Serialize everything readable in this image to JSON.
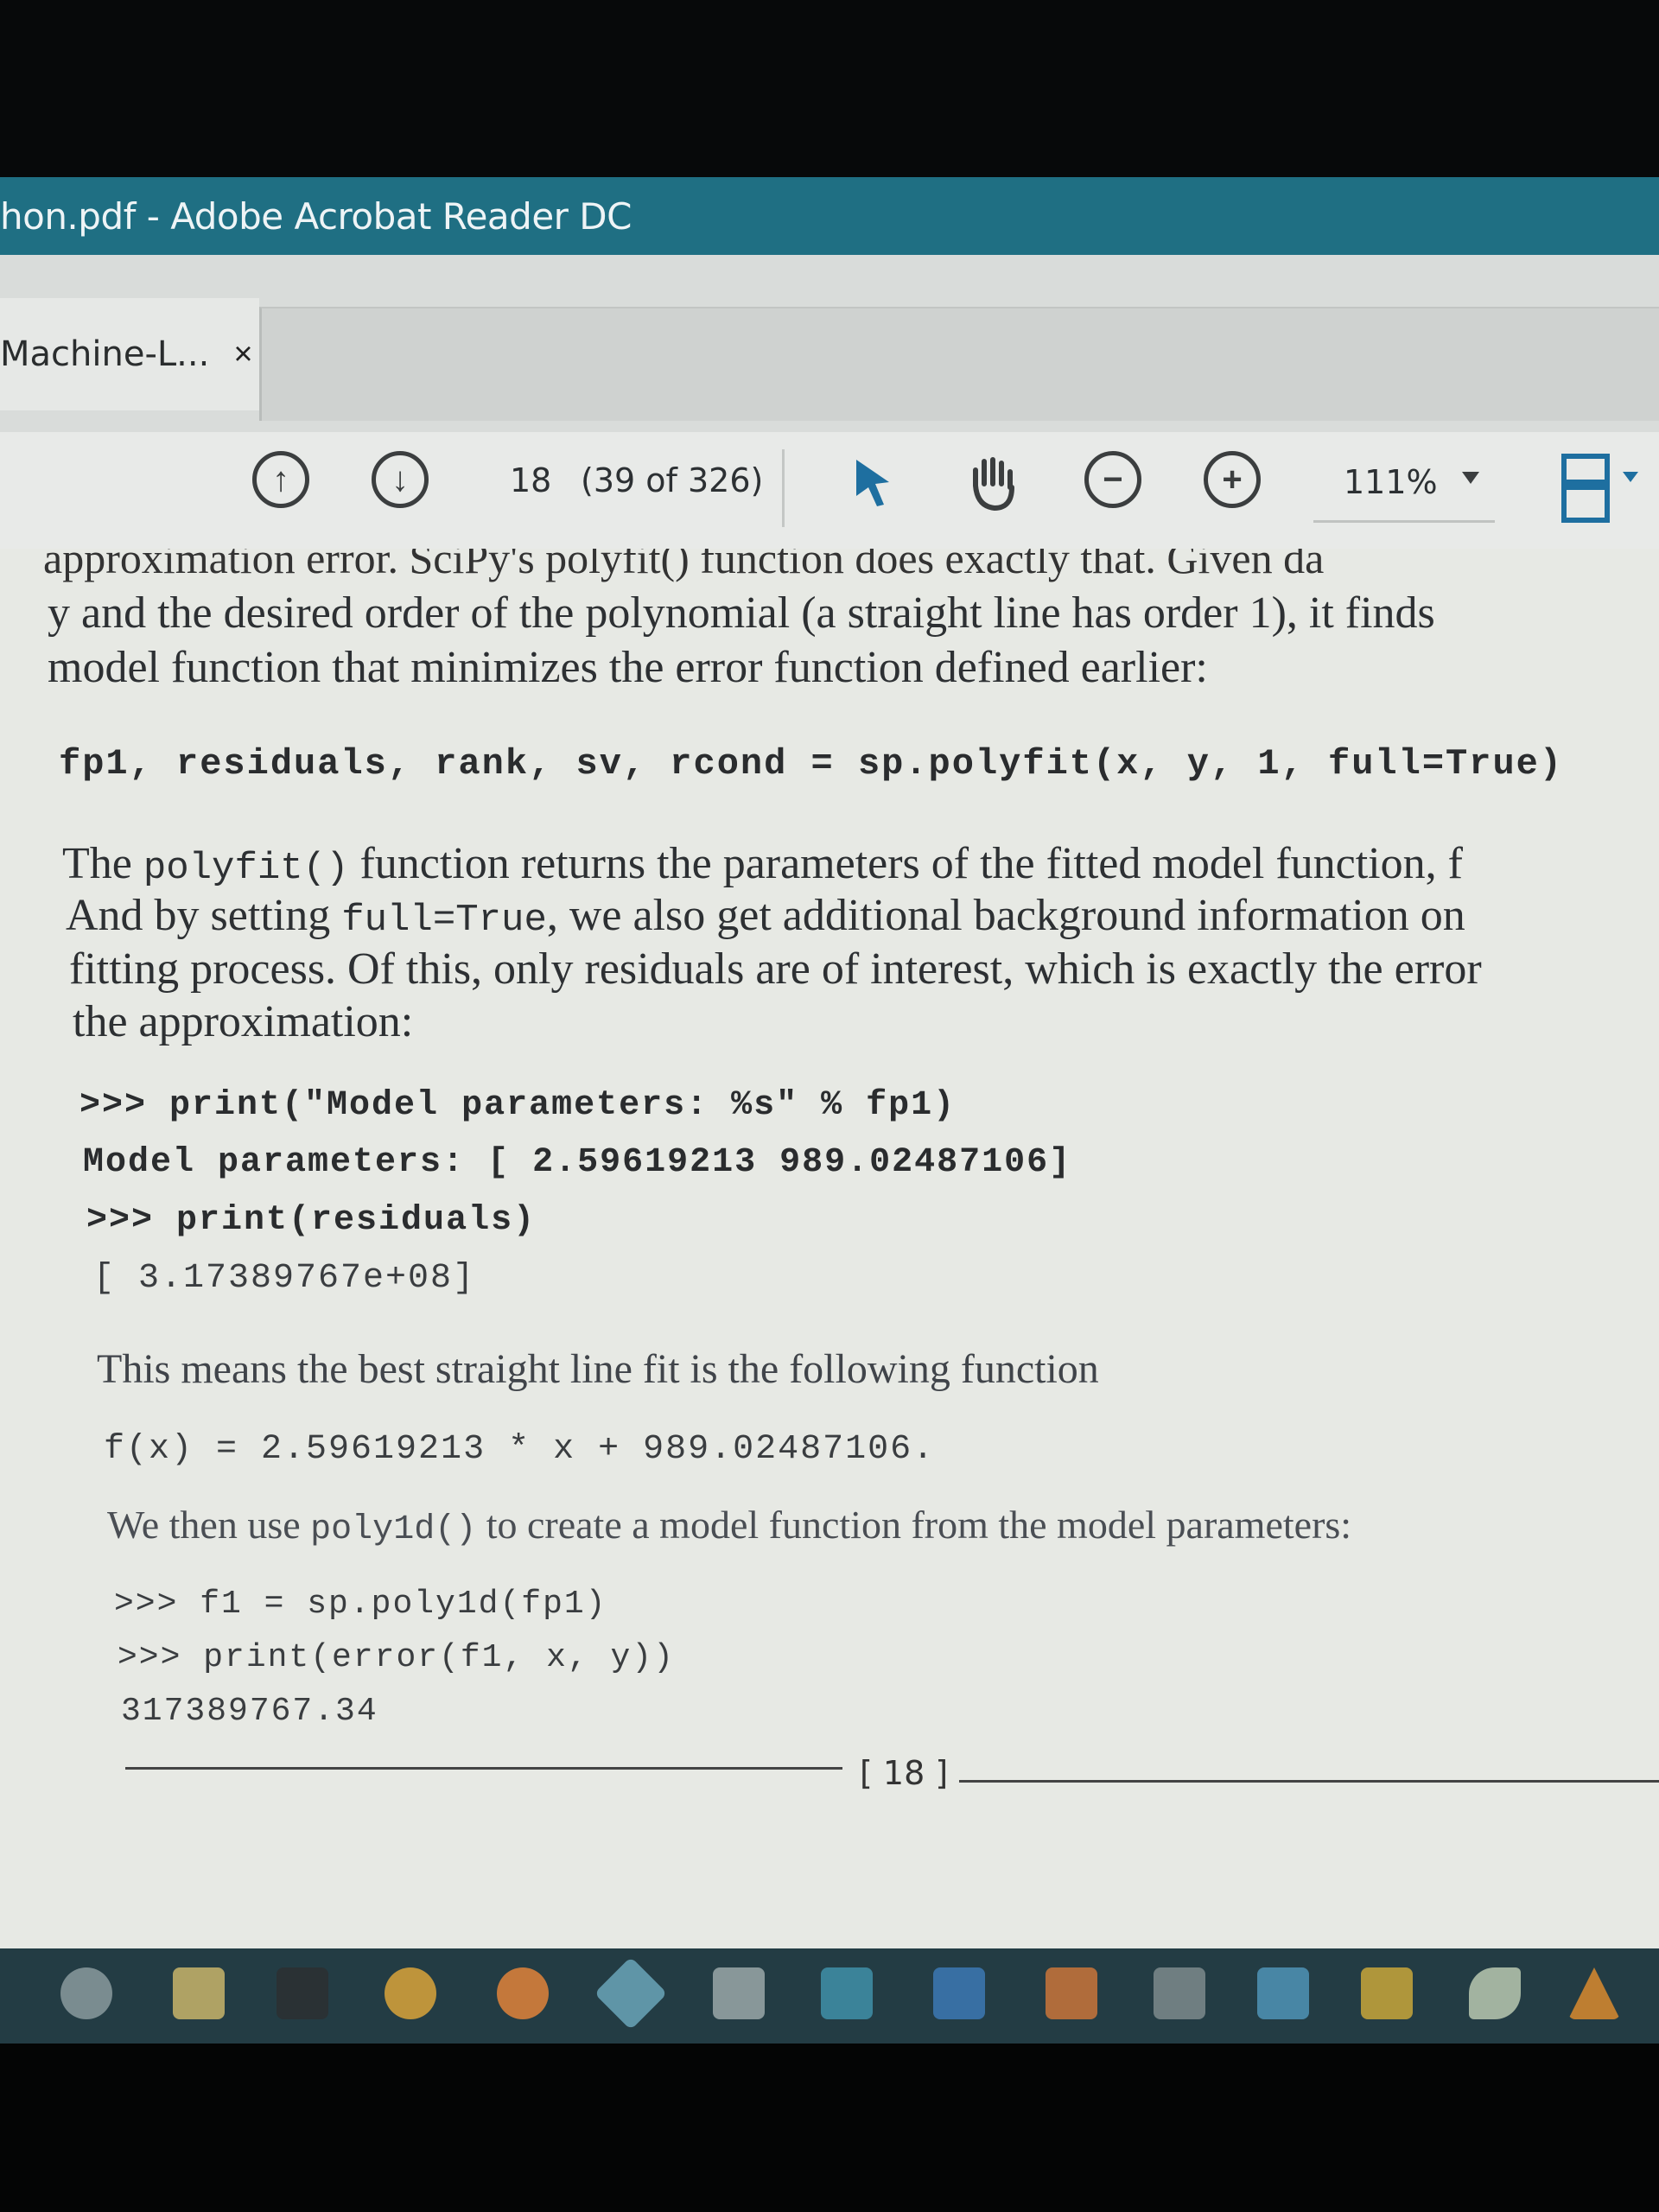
{
  "window": {
    "title": "hon.pdf - Adobe Acrobat Reader DC"
  },
  "tab": {
    "label": "Machine-L...",
    "close": "×"
  },
  "toolbar": {
    "page_number": "18",
    "page_of": "(39 of 326)",
    "zoom": "111%"
  },
  "document": {
    "cut_line": "approximation error. SciPy's polyfit() function does exactly that. Given da",
    "para1": [
      "y and the desired order of the polynomial (a straight line has order 1), it finds",
      "model function that minimizes the error function defined earlier:"
    ],
    "code1": "fp1, residuals, rank, sv, rcond = sp.polyfit(x, y, 1, full=True)",
    "para2": {
      "l1_a": "The ",
      "l1_code": "polyfit()",
      "l1_b": " function returns the parameters of the fitted model function, f",
      "l2_a": "And by setting ",
      "l2_code": "full=True",
      "l2_b": ", we also get additional background information on",
      "l3": "fitting process. Of this, only residuals are of interest, which is exactly the error",
      "l4": "the approximation:"
    },
    "code2": [
      ">>> print(\"Model parameters: %s\" % fp1)",
      "Model parameters: [   2.59619213  989.02487106]",
      ">>> print(residuals)",
      "[  3.17389767e+08]"
    ],
    "para3": "This means the best straight line fit is the following function",
    "formula": "f(x) = 2.59619213 * x + 989.02487106.",
    "para4": {
      "a": "We then use ",
      "code": "poly1d()",
      "b": " to create a model function from the model parameters:"
    },
    "code3": [
      ">>> f1 = sp.poly1d(fp1)",
      ">>> print(error(f1, x, y))",
      "317389767.34"
    ],
    "page_label": "[ 18 ]"
  },
  "taskbar": {
    "icons": [
      "settings-icon",
      "file-explorer-icon",
      "terminal-icon",
      "chrome-icon",
      "firefox-icon",
      "app-icon",
      "calculator-icon",
      "mail-icon",
      "visual-studio-icon",
      "app-orange-icon",
      "app-gray-icon",
      "app-blue-icon",
      "app-yellow-icon",
      "app-leaf-icon",
      "vlc-icon"
    ],
    "colors": {
      "bar": "#233c44",
      "titlebar": "#1f6f83"
    }
  }
}
